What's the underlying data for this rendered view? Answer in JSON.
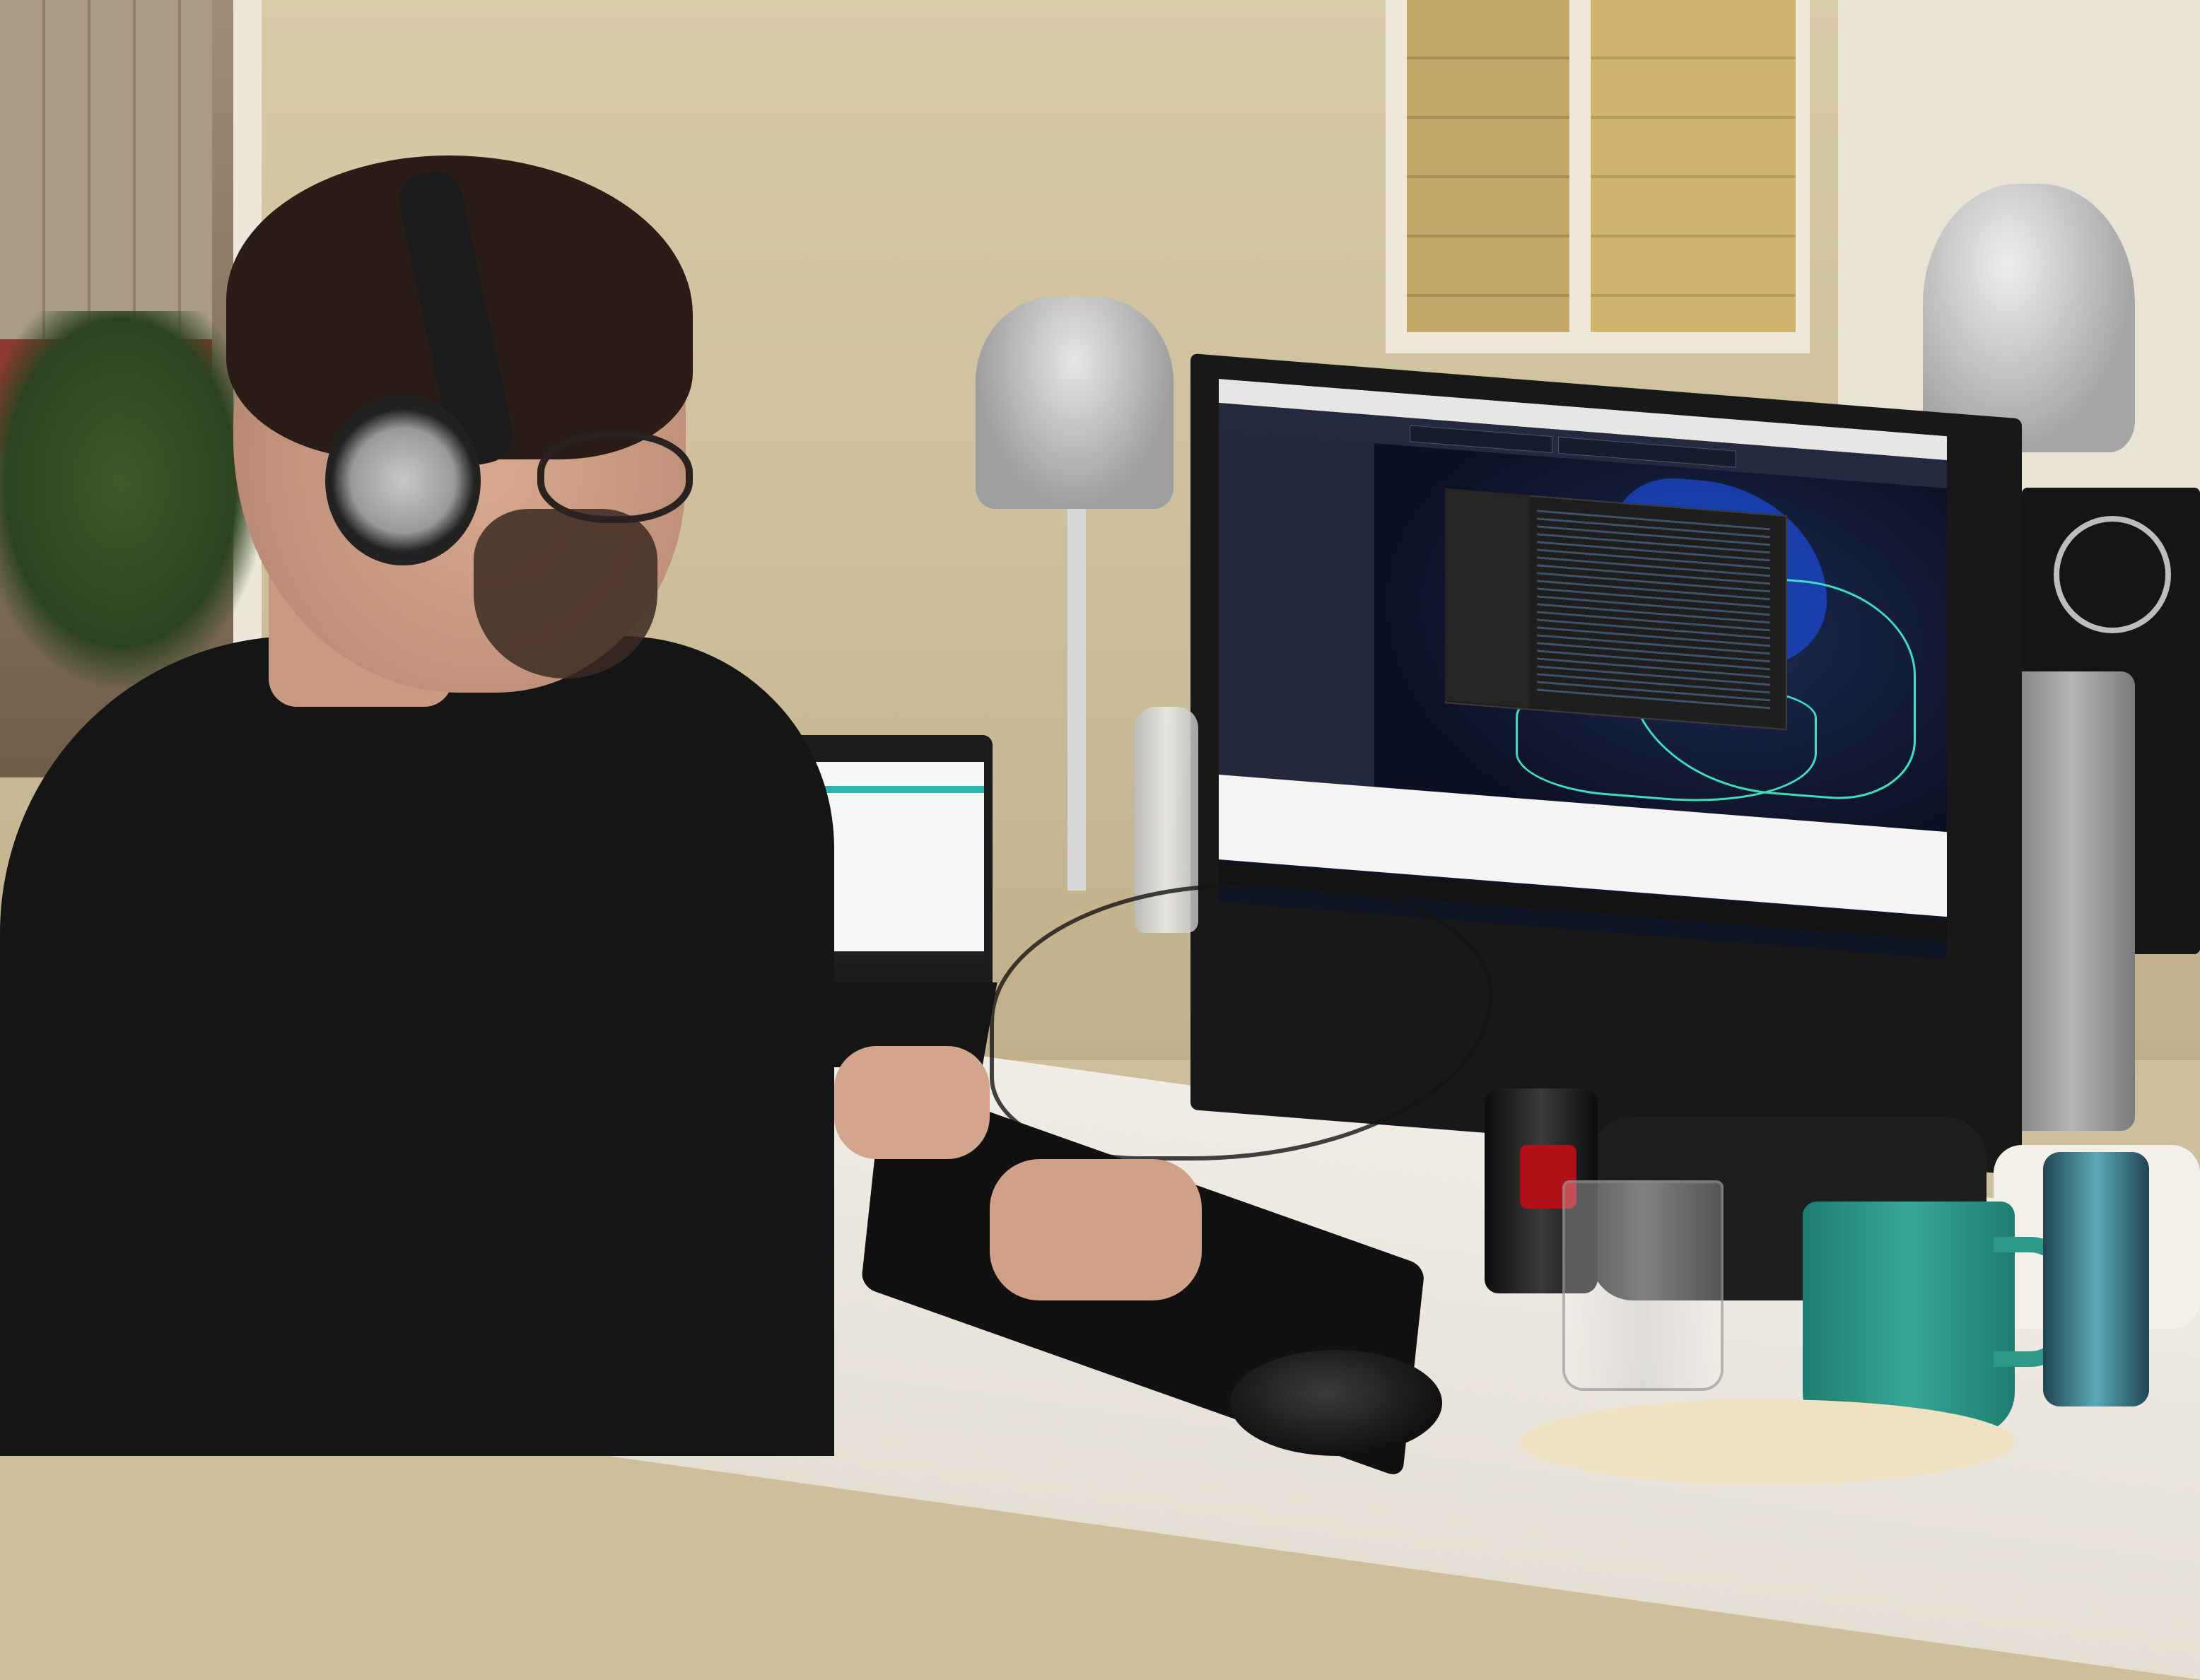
{
  "scene": {
    "setting": "office-desk",
    "objects": {
      "laptop": "laptop",
      "external_monitor": "external-monitor",
      "dell_monitor": "dell-monitor",
      "keyboard": "keyboard",
      "mouse": "mouse",
      "cola_can": "cola-can",
      "energy_drink_can": "energy-can",
      "glass": "glass",
      "mug": "mug",
      "desk_lamps": "desk-lamps",
      "headphones": "headphones"
    },
    "colors": {
      "map_water": "#1b4ad0",
      "map_borders": "#3be0c0",
      "app_dark": "#232a3d",
      "mug_green": "#2c9886",
      "cola_red": "#b10f18"
    }
  }
}
